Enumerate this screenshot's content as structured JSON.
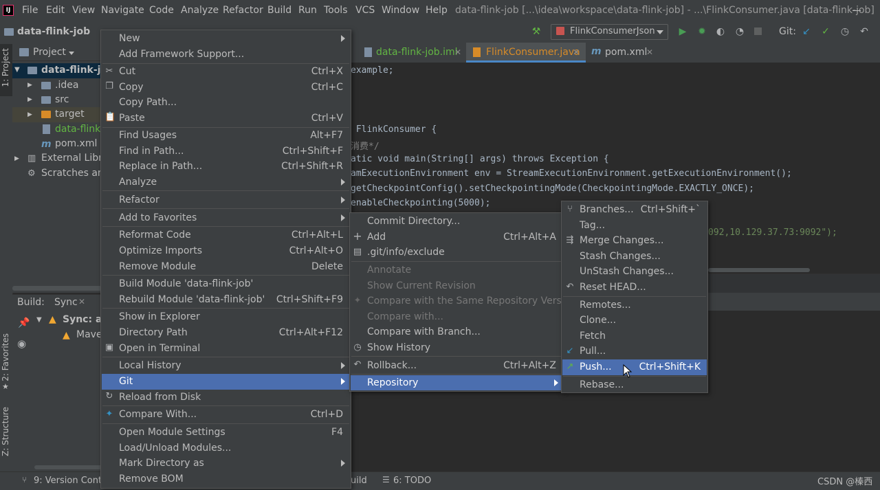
{
  "app": {
    "title": "data-flink-job [...\\idea\\workspace\\data-flink-job] - ...\\FlinkConsumer.java [data-flink-job]",
    "logo": "IJ",
    "menus": [
      "File",
      "Edit",
      "View",
      "Navigate",
      "Code",
      "Analyze",
      "Refactor",
      "Build",
      "Run",
      "Tools",
      "VCS",
      "Window",
      "Help"
    ]
  },
  "navbar": {
    "project": "data-flink-job",
    "run_config": "FlinkConsumerJson",
    "git_label": "Git:"
  },
  "left_stripe": {
    "project_tab": "1: Project",
    "favorites_tab": "2: Favorites",
    "structure_tab": "Z: Structure"
  },
  "project_panel": {
    "title": "Project",
    "tree": [
      {
        "label": "data-flink-job",
        "kind": "root"
      },
      {
        "label": ".idea",
        "kind": "folder"
      },
      {
        "label": "src",
        "kind": "folder"
      },
      {
        "label": "target",
        "kind": "folder-orange"
      },
      {
        "label": "data-flink-",
        "kind": "file-iml"
      },
      {
        "label": "pom.xml",
        "kind": "file-maven"
      },
      {
        "label": "External Libra",
        "kind": "libraries"
      },
      {
        "label": "Scratches and",
        "kind": "scratches"
      }
    ]
  },
  "build_panel": {
    "title": "Build:",
    "tab": "Sync",
    "rows": [
      "Sync: at",
      "Maven"
    ]
  },
  "statusbar": {
    "version_control": "9: Version Contro",
    "build": "uild",
    "todo": "6: TODO",
    "watermark": "CSDN @榛西"
  },
  "editor": {
    "tabs": [
      {
        "label": "data-flink-job.iml",
        "active": false
      },
      {
        "label": "FlinkConsumer.java",
        "active": true
      },
      {
        "label": "pom.xml",
        "active": false
      }
    ],
    "lines": [
      {
        "text": "example;"
      },
      {
        "text": " FlinkConsumer {"
      },
      {
        "text": "消费*/"
      },
      {
        "text": "atic void main(String[] args) throws Exception {"
      },
      {
        "text": "amExecutionEnvironment env = StreamExecutionEnvironment.getExecutionEnvironment();"
      },
      {
        "text": "getCheckpointConfig().setCheckpointingMode(CheckpointingMode.EXACTLY_ONCE);"
      },
      {
        "text": "enableCheckpointing(5000);"
      },
      {
        "text": "092,10.129.37.73:9092\");"
      }
    ]
  },
  "context_menu": {
    "items": [
      {
        "label": "New",
        "shortcut": "",
        "submenu": true
      },
      {
        "label": "Add Framework Support...",
        "shortcut": ""
      },
      {
        "label": "Cut",
        "shortcut": "Ctrl+X",
        "icon": "cut-icon"
      },
      {
        "label": "Copy",
        "shortcut": "Ctrl+C",
        "icon": "copy-icon"
      },
      {
        "label": "Copy Path...",
        "shortcut": ""
      },
      {
        "label": "Paste",
        "shortcut": "Ctrl+V",
        "icon": "paste-icon"
      },
      {
        "label": "Find Usages",
        "shortcut": "Alt+F7"
      },
      {
        "label": "Find in Path...",
        "shortcut": "Ctrl+Shift+F"
      },
      {
        "label": "Replace in Path...",
        "shortcut": "Ctrl+Shift+R"
      },
      {
        "label": "Analyze",
        "shortcut": "",
        "submenu": true
      },
      {
        "label": "Refactor",
        "shortcut": "",
        "submenu": true
      },
      {
        "label": "Add to Favorites",
        "shortcut": "",
        "submenu": true
      },
      {
        "label": "Reformat Code",
        "shortcut": "Ctrl+Alt+L"
      },
      {
        "label": "Optimize Imports",
        "shortcut": "Ctrl+Alt+O"
      },
      {
        "label": "Remove Module",
        "shortcut": "Delete"
      },
      {
        "label": "Build Module 'data-flink-job'",
        "shortcut": ""
      },
      {
        "label": "Rebuild Module 'data-flink-job'",
        "shortcut": "Ctrl+Shift+F9"
      },
      {
        "label": "Show in Explorer",
        "shortcut": ""
      },
      {
        "label": "Directory Path",
        "shortcut": "Ctrl+Alt+F12"
      },
      {
        "label": "Open in Terminal",
        "shortcut": "",
        "icon": "terminal-icon"
      },
      {
        "label": "Local History",
        "shortcut": "",
        "submenu": true
      },
      {
        "label": "Git",
        "shortcut": "",
        "submenu": true,
        "highlighted": true
      },
      {
        "label": "Reload from Disk",
        "shortcut": "",
        "icon": "reload-icon"
      },
      {
        "label": "Compare With...",
        "shortcut": "Ctrl+D",
        "icon": "compare-icon"
      },
      {
        "label": "Open Module Settings",
        "shortcut": "F4"
      },
      {
        "label": "Load/Unload Modules...",
        "shortcut": ""
      },
      {
        "label": "Mark Directory as",
        "shortcut": "",
        "submenu": true
      },
      {
        "label": "Remove BOM",
        "shortcut": ""
      }
    ]
  },
  "git_menu": {
    "items": [
      {
        "label": "Commit Directory...",
        "shortcut": ""
      },
      {
        "label": "Add",
        "shortcut": "Ctrl+Alt+A",
        "icon": "plus-icon"
      },
      {
        "label": ".git/info/exclude",
        "shortcut": "",
        "icon": "git-file-icon"
      },
      {
        "label": "Annotate",
        "shortcut": "",
        "disabled": true
      },
      {
        "label": "Show Current Revision",
        "shortcut": "",
        "disabled": true
      },
      {
        "label": "Compare with the Same Repository Version",
        "shortcut": "",
        "disabled": true,
        "icon": "compare-icon"
      },
      {
        "label": "Compare with...",
        "shortcut": "",
        "disabled": true
      },
      {
        "label": "Compare with Branch...",
        "shortcut": ""
      },
      {
        "label": "Show History",
        "shortcut": "",
        "icon": "history-icon"
      },
      {
        "label": "Rollback...",
        "shortcut": "Ctrl+Alt+Z",
        "icon": "rollback-icon"
      },
      {
        "label": "Repository",
        "shortcut": "",
        "submenu": true,
        "highlighted": true
      }
    ]
  },
  "repo_menu": {
    "items": [
      {
        "label": "Branches...",
        "shortcut": "Ctrl+Shift+`",
        "icon": "branch-icon"
      },
      {
        "label": "Tag...",
        "shortcut": ""
      },
      {
        "label": "Merge Changes...",
        "shortcut": "",
        "icon": "merge-icon"
      },
      {
        "label": "Stash Changes...",
        "shortcut": ""
      },
      {
        "label": "UnStash Changes...",
        "shortcut": ""
      },
      {
        "label": "Reset HEAD...",
        "shortcut": "",
        "icon": "reset-icon"
      },
      {
        "label": "Remotes...",
        "shortcut": ""
      },
      {
        "label": "Clone...",
        "shortcut": ""
      },
      {
        "label": "Fetch",
        "shortcut": ""
      },
      {
        "label": "Pull...",
        "shortcut": "",
        "icon": "pull-icon"
      },
      {
        "label": "Push...",
        "shortcut": "Ctrl+Shift+K",
        "icon": "push-icon",
        "highlighted": true
      },
      {
        "label": "Rebase...",
        "shortcut": ""
      }
    ]
  },
  "colors": {
    "background": "#2b2b2b",
    "panel": "#3c3f41",
    "highlight": "#4b6eaf",
    "text": "#bbbbbb",
    "disabled": "#777777",
    "keyword": "#cc7832",
    "number": "#6897bb",
    "string": "#6a8759"
  }
}
